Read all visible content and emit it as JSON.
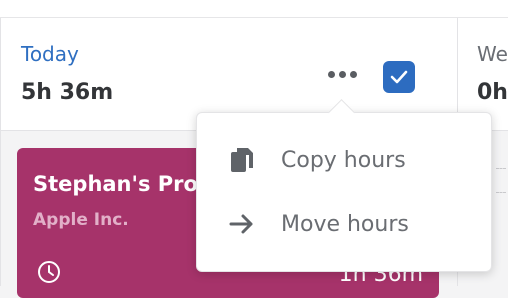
{
  "day_today": {
    "name": "Today",
    "total": "5h 36m"
  },
  "day_next": {
    "name": "We",
    "total": "0h"
  },
  "time_entry": {
    "project": "Stephan's Pro",
    "client": "Apple Inc.",
    "duration": "1h 36m",
    "color": "#a6336a"
  },
  "menu": {
    "items": [
      {
        "label": "Copy hours",
        "icon": "copy-icon"
      },
      {
        "label": "Move hours",
        "icon": "arrow-right-icon"
      }
    ]
  },
  "colors": {
    "accent": "#2d6cc0",
    "today_label": "#2f6fc1",
    "entry_bg": "#a6336a"
  }
}
